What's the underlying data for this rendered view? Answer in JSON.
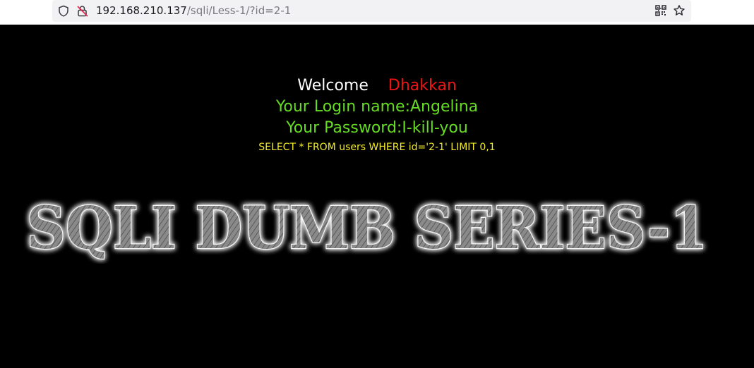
{
  "browser": {
    "url_host": "192.168.210.137",
    "url_path": "/sqli/Less-1/?id=2-1",
    "icons": [
      "shield-icon",
      "insecure-connection-icon",
      "qr-code-icon",
      "bookmark-star-icon"
    ]
  },
  "page": {
    "welcome_word": "Welcome",
    "welcome_name": "Dhakkan",
    "login_line": "Your Login name:Angelina",
    "password_line": "Your Password:I-kill-you",
    "sql_query": "SELECT * FROM users WHERE id='2-1' LIMIT 0,1",
    "banner_text": "SQLI DUMB SERIES-1"
  },
  "colors": {
    "background": "#000000",
    "welcome": "#ffffff",
    "name": "#ee1414",
    "credentials": "#66dd22",
    "query": "#f2ea2a"
  }
}
